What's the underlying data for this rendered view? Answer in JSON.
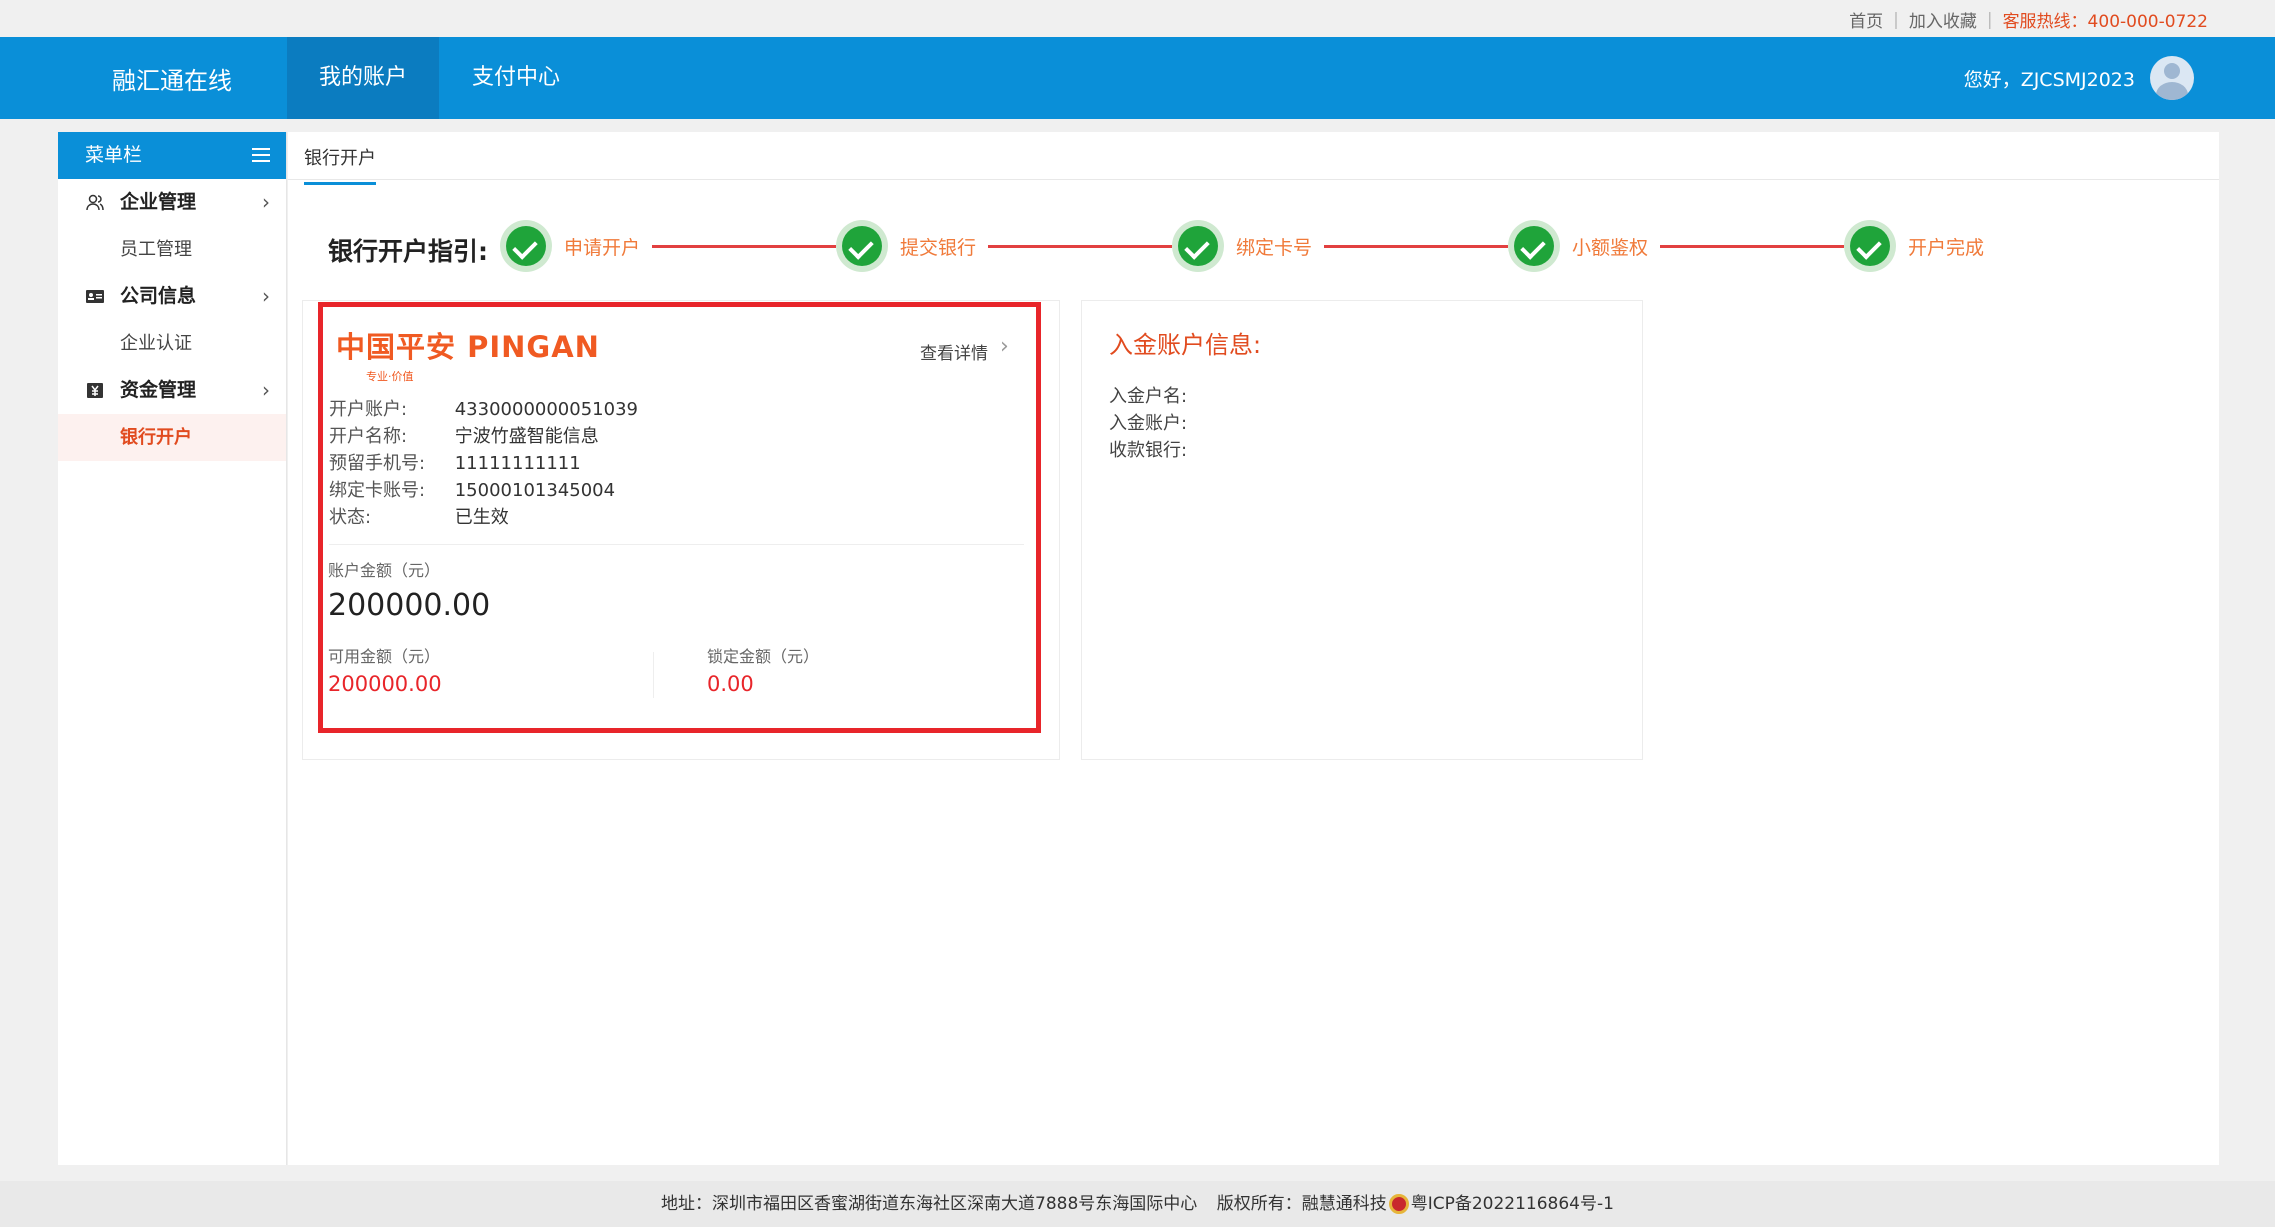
{
  "topbar": {
    "home": "首页",
    "favorite": "加入收藏",
    "hotline": "客服热线：400-000-0722"
  },
  "header": {
    "brand": "融汇通在线",
    "nav": [
      "我的账户",
      "支付中心"
    ],
    "greeting": "您好，ZJCSMJ2023"
  },
  "sidebar": {
    "title": "菜单栏",
    "groups": [
      {
        "label": "企业管理",
        "icon": "users-icon",
        "items": [
          "员工管理"
        ]
      },
      {
        "label": "公司信息",
        "icon": "id-card-icon",
        "items": [
          "企业认证"
        ]
      },
      {
        "label": "资金管理",
        "icon": "money-icon",
        "items": [
          "银行开户"
        ]
      }
    ],
    "active_item": "银行开户"
  },
  "tab": "银行开户",
  "guide": {
    "title": "银行开户指引:",
    "steps": [
      "申请开户",
      "提交银行",
      "绑定卡号",
      "小额鉴权",
      "开户完成"
    ]
  },
  "account_card": {
    "logo_text": "中国平安 PINGAN",
    "logo_sub": "专业·价值",
    "detail_link": "查看详情",
    "rows": [
      {
        "label": "开户账户:",
        "value": "4330000000051039"
      },
      {
        "label": "开户名称:",
        "value": "宁波竹盛智能信息"
      },
      {
        "label": "预留手机号:",
        "value": "11111111111"
      },
      {
        "label": "绑定卡账号:",
        "value": "15000101345004"
      },
      {
        "label": "状态:",
        "value": "已生效"
      }
    ],
    "balance_label": "账户金额（元）",
    "balance": "200000.00",
    "available_label": "可用金额（元）",
    "available": "200000.00",
    "locked_label": "锁定金额（元）",
    "locked": "0.00"
  },
  "deposit_card": {
    "title": "入金账户信息:",
    "rows": [
      "入金户名:",
      "入金账户:",
      "收款银行:"
    ]
  },
  "footer": {
    "address": "地址：深圳市福田区香蜜湖街道东海社区深南大道7888号东海国际中心",
    "copyright": "版权所有：融慧通科技",
    "icp": "粤ICP备2022116864号-1"
  },
  "colors": {
    "primary": "#0a8fd8",
    "accent": "#e14b1f",
    "success": "#1fa43a",
    "highlight_box": "#e8252a"
  }
}
